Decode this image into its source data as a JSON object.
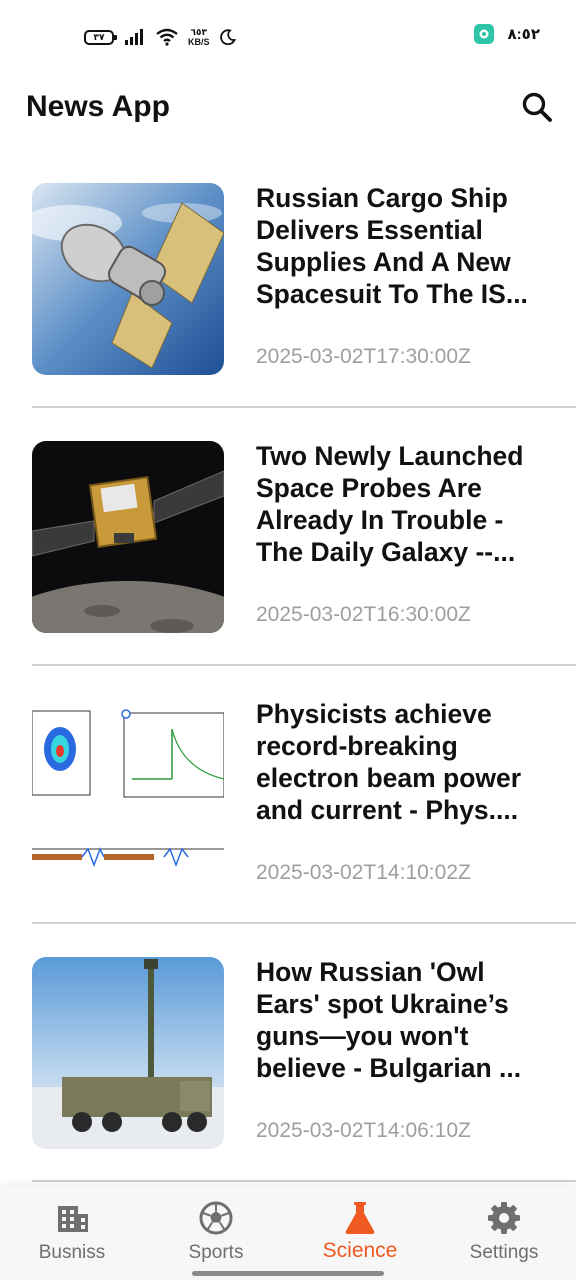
{
  "status_bar": {
    "battery": "٣٧",
    "net_speed_value": "٦٥٣",
    "net_speed_unit": "KB/S",
    "clock": "٨:٥٢"
  },
  "app_bar": {
    "title": "News App",
    "search_icon": "search-icon"
  },
  "articles": [
    {
      "title": "Russian Cargo Ship Delivers Essential Supplies And A New Spacesuit To The IS...",
      "published": "2025-03-02T17:30:00Z"
    },
    {
      "title": "Two Newly Launched Space Probes Are Already In Trouble - The Daily Galaxy --...",
      "published": "2025-03-02T16:30:00Z"
    },
    {
      "title": "Physicists achieve record-breaking electron beam power and current - Phys....",
      "published": "2025-03-02T14:10:02Z"
    },
    {
      "title": "How Russian 'Owl Ears' spot Ukraine’s guns—you won't believe - Bulgarian ...",
      "published": "2025-03-02T14:06:10Z"
    }
  ],
  "bottom_nav": {
    "items": [
      {
        "label": "Busniss",
        "icon": "building-icon",
        "active": false
      },
      {
        "label": "Sports",
        "icon": "soccer-ball-icon",
        "active": false
      },
      {
        "label": "Science",
        "icon": "flask-icon",
        "active": true
      },
      {
        "label": "Settings",
        "icon": "gear-icon",
        "active": false
      }
    ]
  },
  "colors": {
    "accent": "#f05a22",
    "text_primary": "#111111",
    "text_secondary": "#9e9e9e",
    "divider": "#cfcfcf",
    "nav_inactive": "#6f6f6f"
  }
}
